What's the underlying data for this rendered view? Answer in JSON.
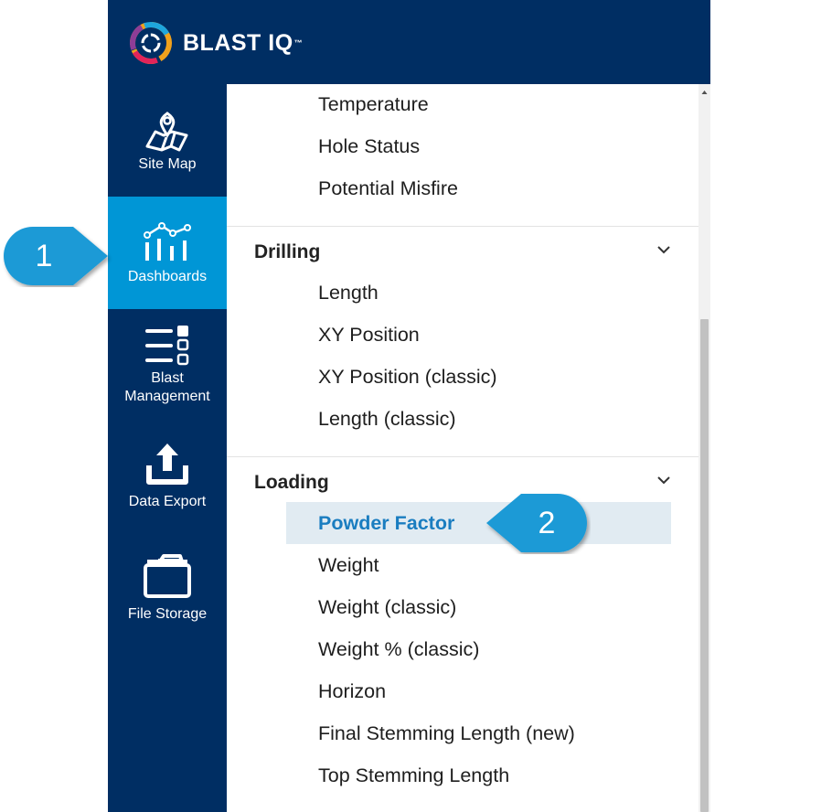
{
  "brand": {
    "name": "BLAST IQ",
    "trademark": "™"
  },
  "rail": [
    {
      "label": "Site Map",
      "icon": "map-pin-icon"
    },
    {
      "label": "Dashboards",
      "icon": "dashboard-chart-icon",
      "active": true
    },
    {
      "label": "Blast Management",
      "icon": "list-checkbox-icon"
    },
    {
      "label": "Data Export",
      "icon": "upload-icon"
    },
    {
      "label": "File Storage",
      "icon": "folder-icon"
    }
  ],
  "menu": {
    "top_items": [
      "Temperature",
      "Hole Status",
      "Potential Misfire"
    ],
    "drilling": {
      "title": "Drilling",
      "items": [
        "Length",
        "XY Position",
        "XY Position (classic)",
        "Length (classic)"
      ]
    },
    "loading": {
      "title": "Loading",
      "items": [
        "Powder Factor",
        "Weight",
        "Weight (classic)",
        "Weight % (classic)",
        "Horizon",
        "Final Stemming Length (new)",
        "Top Stemming Length"
      ],
      "selected": "Powder Factor"
    }
  },
  "callouts": [
    "1",
    "2"
  ],
  "colors": {
    "navy": "#002e63",
    "active_blue": "#0096d6",
    "selected_text": "#1a7dc0",
    "highlight_bg": "#e1ebf2",
    "callout": "#1e9ad6"
  }
}
